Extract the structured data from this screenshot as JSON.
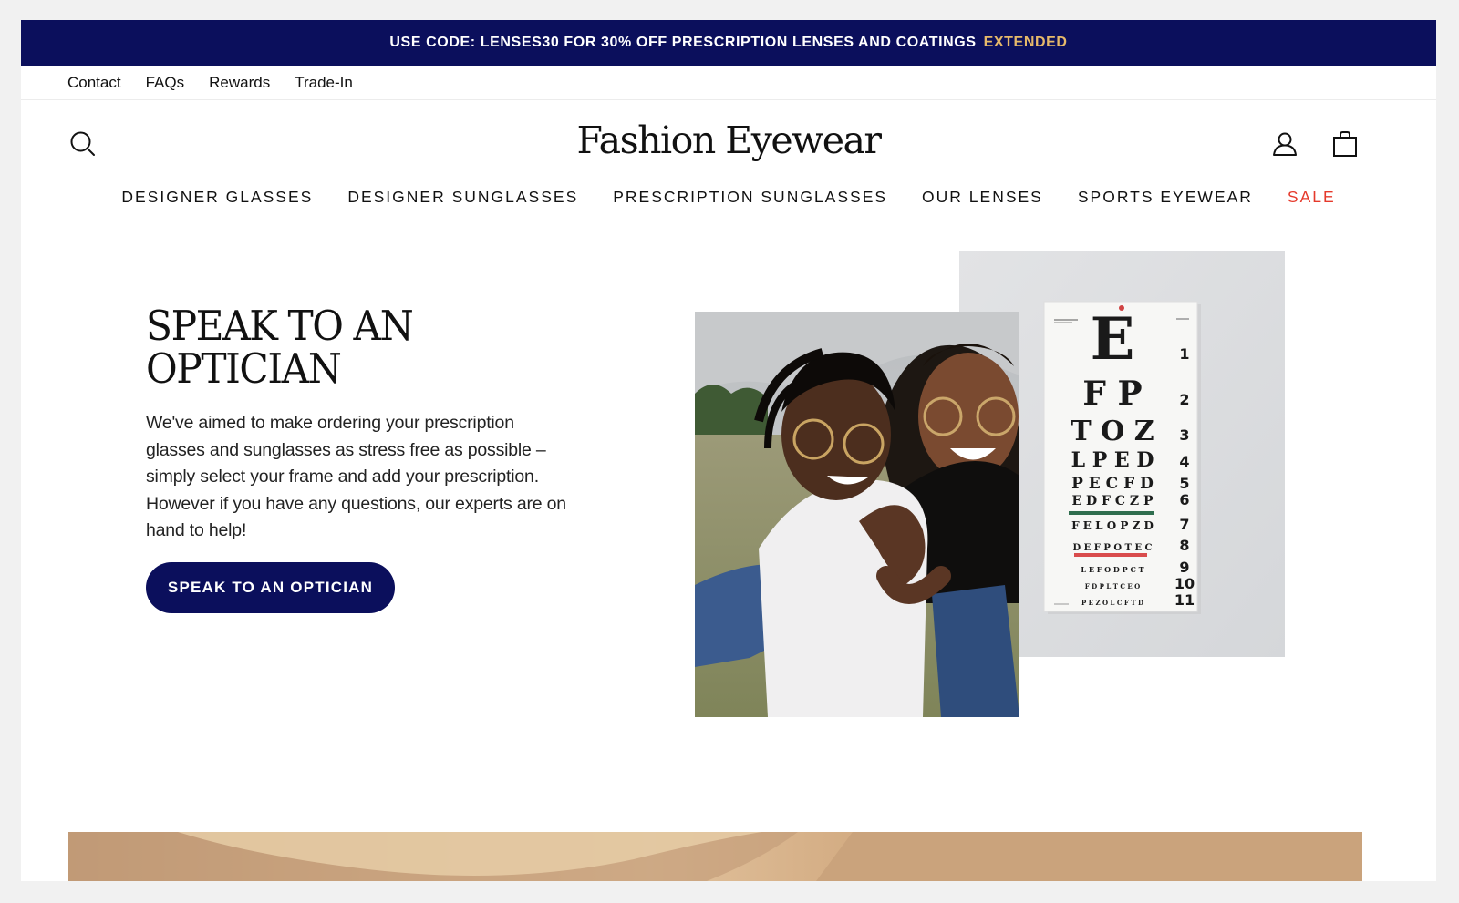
{
  "promo": {
    "text": "USE CODE: LENSES30 FOR 30% OFF PRESCRIPTION LENSES AND COATINGS",
    "highlight": "EXTENDED"
  },
  "utility_nav": {
    "items": [
      "Contact",
      "FAQs",
      "Rewards",
      "Trade-In"
    ]
  },
  "header": {
    "logo": "Fashion Eyewear",
    "icons": [
      "search-icon",
      "account-icon",
      "shopping-bag-icon"
    ]
  },
  "main_nav": {
    "items": [
      "DESIGNER GLASSES",
      "DESIGNER SUNGLASSES",
      "PRESCRIPTION SUNGLASSES",
      "OUR LENSES",
      "SPORTS EYEWEAR",
      "SALE"
    ]
  },
  "hero": {
    "title_line1": "SPEAK TO AN",
    "title_line2": "OPTICIAN",
    "body": "We've aimed to make ordering your prescription glasses and sunglasses as stress free as possible – simply select your frame and add your prescription. However if you have any questions, our experts are on hand to help!",
    "cta_label": "SPEAK TO AN OPTICIAN"
  },
  "eye_chart": {
    "rows": [
      {
        "letters": "E",
        "number": "1"
      },
      {
        "letters": "F P",
        "number": "2"
      },
      {
        "letters": "T O Z",
        "number": "3"
      },
      {
        "letters": "L P E D",
        "number": "4"
      },
      {
        "letters": "P E C F D",
        "number": "5"
      },
      {
        "letters": "E D F C Z P",
        "number": "6"
      },
      {
        "letters": "F E L O P Z D",
        "number": "7"
      },
      {
        "letters": "D E F P O T E C",
        "number": "8"
      },
      {
        "letters": "L E F O D P C T",
        "number": "9"
      },
      {
        "letters": "F D P L T C E O",
        "number": "10"
      },
      {
        "letters": "P E Z O L C F T D",
        "number": "11"
      }
    ]
  },
  "colors": {
    "brand_navy": "#0b0f5c",
    "promo_highlight": "#e6b96a",
    "sale_red": "#e5392b"
  }
}
